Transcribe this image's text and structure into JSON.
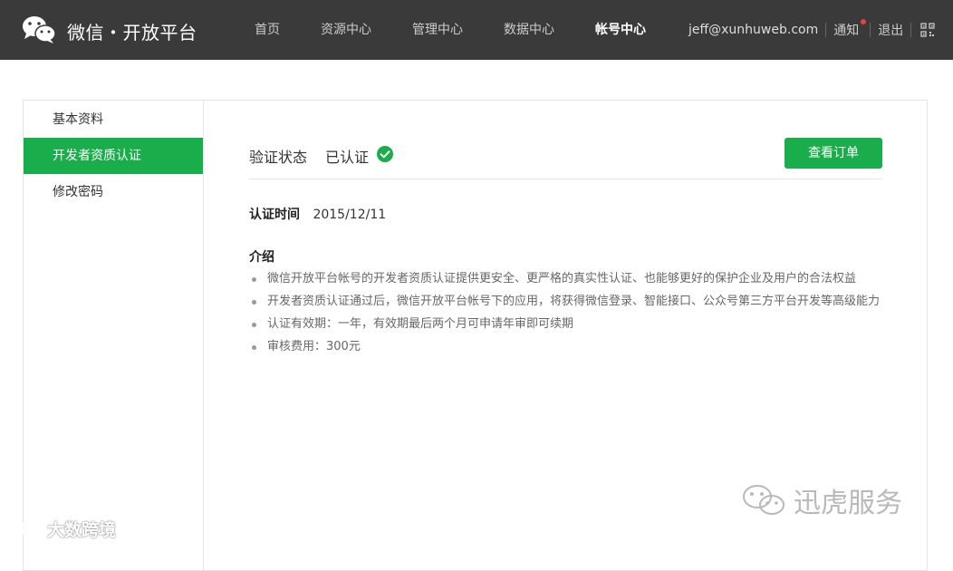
{
  "header": {
    "brand": "微信・开放平台",
    "nav": [
      {
        "label": "首页"
      },
      {
        "label": "资源中心"
      },
      {
        "label": "管理中心"
      },
      {
        "label": "数据中心"
      },
      {
        "label": "帐号中心",
        "active": true
      }
    ],
    "user_email": "jeff@xunhuweb.com",
    "notice_label": "通知",
    "logout_label": "退出",
    "icons": {
      "logo": "wechat-logo-icon",
      "notice_dot": "red-dot",
      "qr": "qr-code-icon"
    }
  },
  "sidebar": {
    "items": [
      {
        "label": "基本资料"
      },
      {
        "label": "开发者资质认证",
        "active": true
      },
      {
        "label": "修改密码"
      }
    ]
  },
  "main": {
    "status_label": "验证状态",
    "status_value": "已认证",
    "status_icon": "check-circle-icon",
    "order_button": "查看订单",
    "time_label": "认证时间",
    "time_value": "2015/12/11",
    "intro_title": "介绍",
    "intro_items": [
      "微信开放平台帐号的开发者资质认证提供更安全、更严格的真实性认证、也能够更好的保护企业及用户的合法权益",
      "开发者资质认证通过后，微信开放平台帐号下的应用，将获得微信登录、智能接口、公众号第三方平台开发等高级能力",
      "认证有效期：一年，有效期最后两个月可申请年审即可续期",
      "审核费用：300元"
    ]
  },
  "watermarks": {
    "right": "迅虎服务",
    "left": "大数跨境"
  },
  "colors": {
    "topbar": "#3a3a3a",
    "accent_green": "#1aad4b",
    "notice_dot": "#e64340"
  }
}
